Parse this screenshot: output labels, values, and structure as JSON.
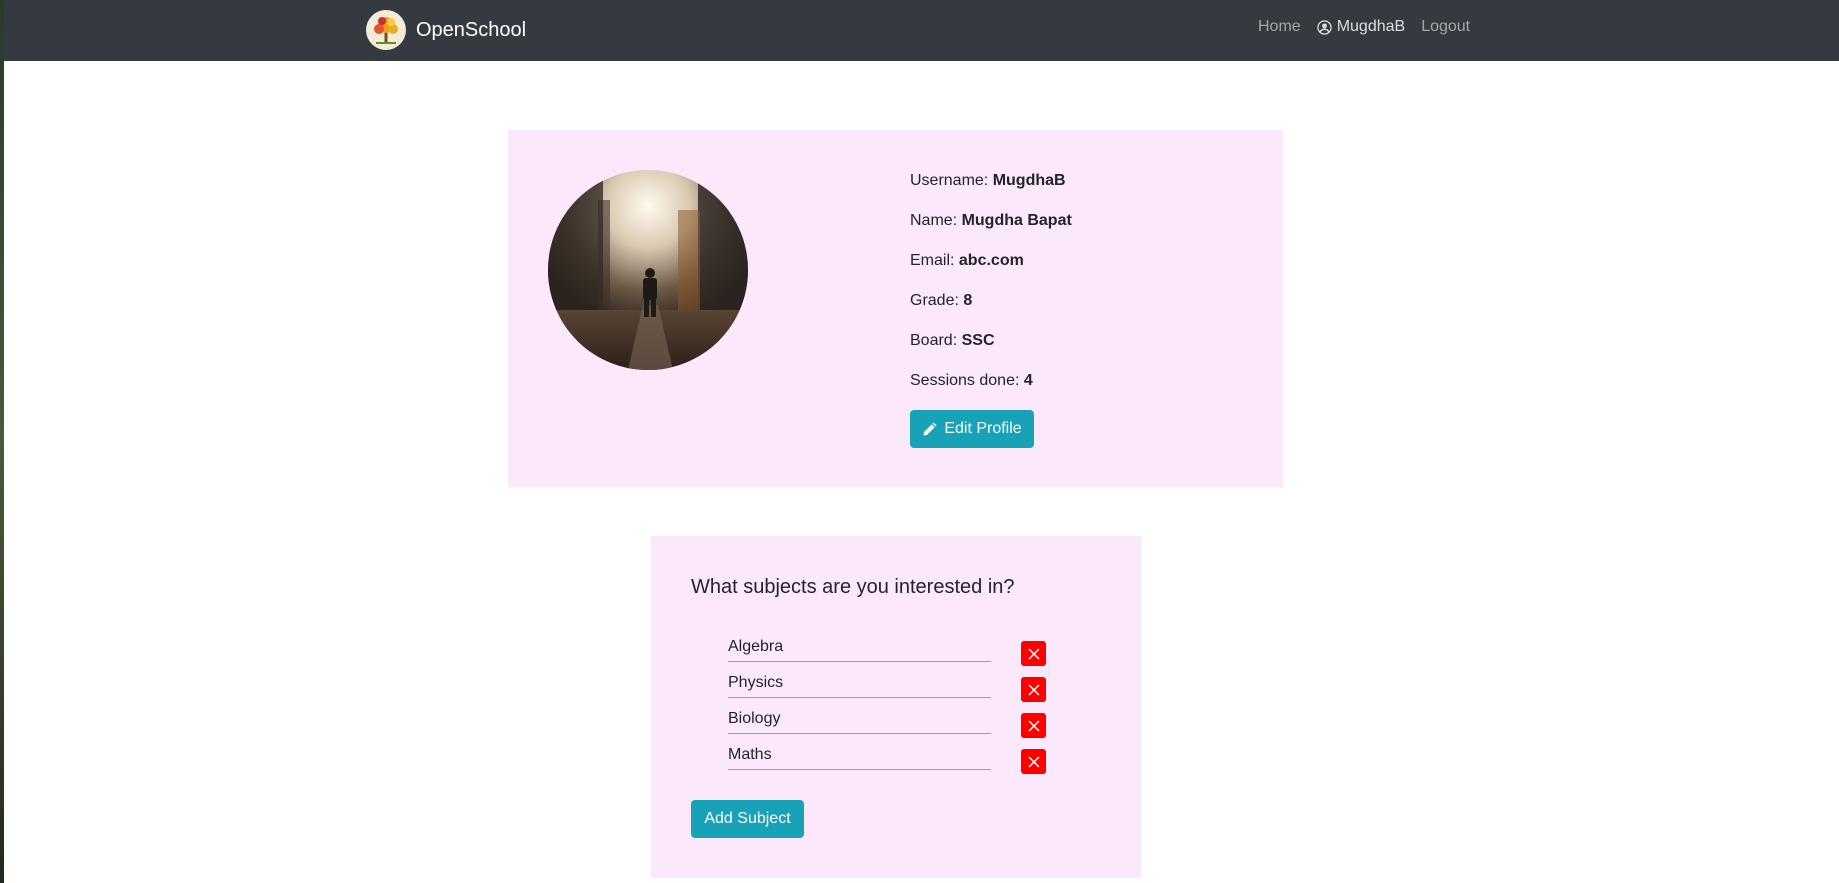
{
  "app": {
    "name": "OpenSchool",
    "nav": {
      "home": "Home",
      "user": "MugdhaB",
      "logout": "Logout"
    }
  },
  "profile": {
    "fields": [
      {
        "label": "Username: ",
        "value": "MugdhaB"
      },
      {
        "label": "Name: ",
        "value": "Mugdha Bapat"
      },
      {
        "label": "Email: ",
        "value": "abc.com"
      },
      {
        "label": "Grade: ",
        "value": "8"
      },
      {
        "label": "Board: ",
        "value": "SSC"
      },
      {
        "label": "Sessions done: ",
        "value": "4"
      }
    ],
    "edit_button": "Edit Profile"
  },
  "subjects": {
    "title": "What subjects are you interested in?",
    "items": [
      "Algebra",
      "Physics",
      "Biology",
      "Maths"
    ],
    "add_button": "Add Subject"
  },
  "colors": {
    "navbar": "#343a40",
    "card_bg": "#fbe9fb",
    "button": "#17a2b8",
    "remove": "#ff0000"
  },
  "icons": {
    "user": "user-circle-icon",
    "edit": "pencil-icon",
    "remove": "close-icon"
  }
}
